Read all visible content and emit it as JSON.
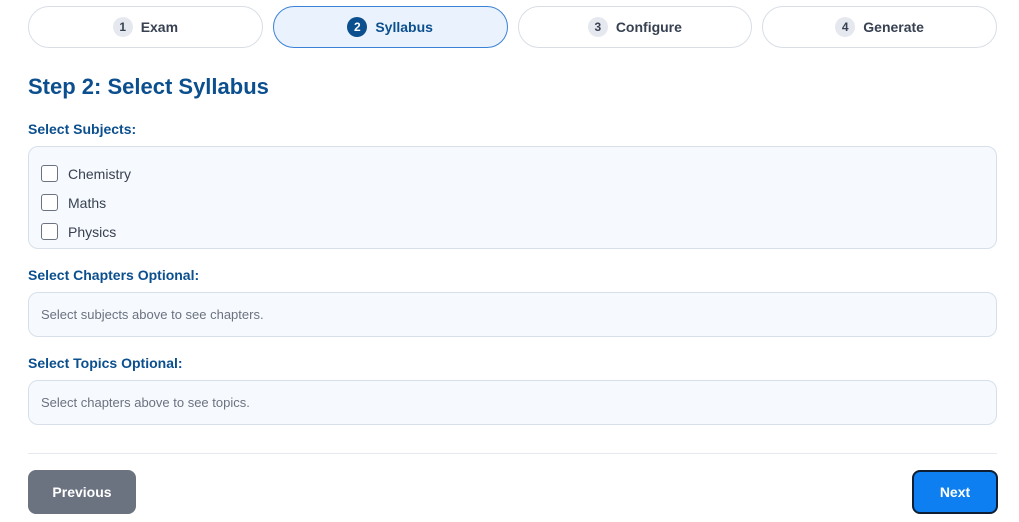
{
  "stepper": {
    "steps": [
      {
        "num": "1",
        "label": "Exam"
      },
      {
        "num": "2",
        "label": "Syllabus"
      },
      {
        "num": "3",
        "label": "Configure"
      },
      {
        "num": "4",
        "label": "Generate"
      }
    ],
    "active_index": 1
  },
  "page": {
    "title": "Step 2: Select Syllabus"
  },
  "subjects": {
    "label": "Select Subjects:",
    "items": [
      {
        "label": "Chemistry",
        "checked": false
      },
      {
        "label": "Maths",
        "checked": false
      },
      {
        "label": "Physics",
        "checked": false
      }
    ]
  },
  "chapters": {
    "label": "Select Chapters Optional:",
    "placeholder": "Select subjects above to see chapters."
  },
  "topics": {
    "label": "Select Topics Optional:",
    "placeholder": "Select chapters above to see topics."
  },
  "footer": {
    "previous_label": "Previous",
    "next_label": "Next"
  },
  "colors": {
    "accent": "#0b4f8e",
    "primary_button": "#0d7ff0",
    "secondary_button": "#6b7280"
  }
}
